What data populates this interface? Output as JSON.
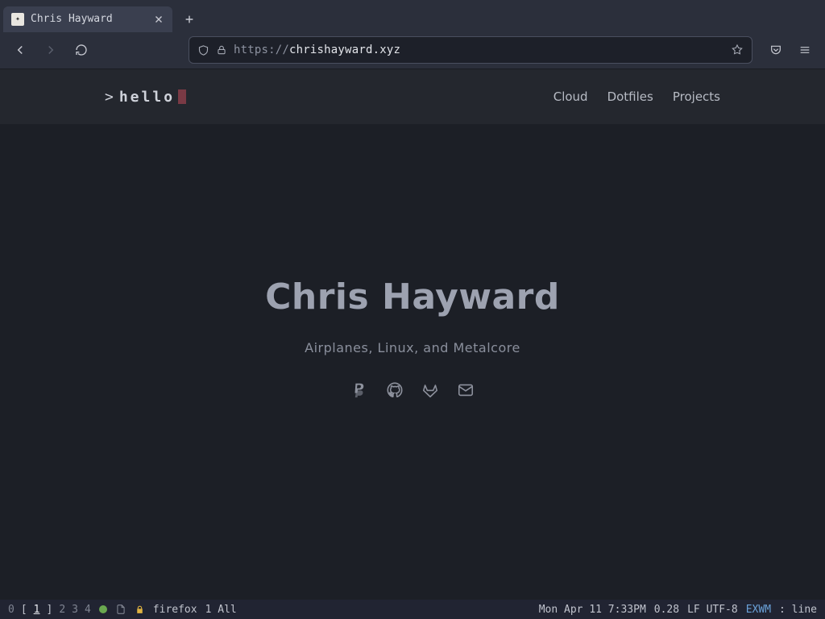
{
  "browser": {
    "tab_title": "Chris Hayward",
    "url_prefix": "https://",
    "url_host": "chrishayward.xyz",
    "url_path": ""
  },
  "site": {
    "logo_prompt": ">",
    "logo_text": "hello",
    "nav": {
      "cloud": "Cloud",
      "dotfiles": "Dotfiles",
      "projects": "Projects"
    },
    "hero": {
      "title": "Chris Hayward",
      "tagline": "Airplanes, Linux, and Metalcore"
    }
  },
  "modeline": {
    "ws0": "0",
    "ws1": "1",
    "ws2": "2",
    "ws3": "3",
    "ws4": "4",
    "buffer": "firefox",
    "pos": "1 All",
    "datetime": "Mon Apr 11 7:33PM",
    "load": "0.28",
    "encoding": "LF UTF-8",
    "mode": "EXWM",
    "minor": ": line"
  }
}
